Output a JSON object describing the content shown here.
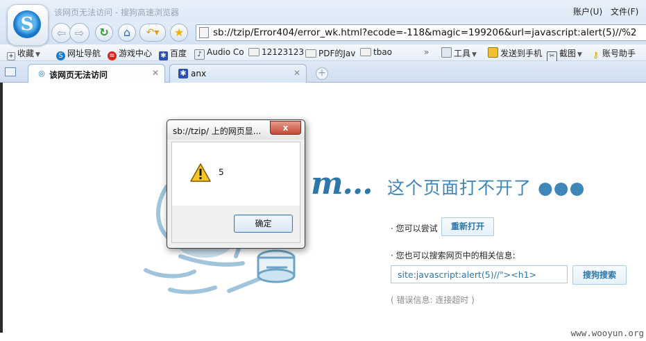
{
  "window": {
    "title": "该网页无法访问 - 搜狗高速浏览器",
    "menu": {
      "account": "账户(U)",
      "file": "文件(F)"
    }
  },
  "toolbar": {
    "address": "sb://tzip/Error404/error_wk.html?ecode=-118&magic=199206&url=javascript:alert(5)//%2"
  },
  "bookmarks": {
    "items": [
      "收藏",
      "网址导航",
      "游戏中心",
      "百度",
      "Audio Co",
      "12123123",
      "PDF的Jav",
      "tbao"
    ],
    "more": "»",
    "tools": [
      "工具",
      "发送到手机",
      "截图",
      "账号助手"
    ]
  },
  "tabs": [
    {
      "label": "该网页无法访问",
      "active": true
    },
    {
      "label": "anx",
      "active": false
    }
  ],
  "page": {
    "logo_text": "m...",
    "heading": "这个页面打不开了 ●●●",
    "try_label": "· 您可以尝试",
    "reopen_button": "重新打开",
    "search_label": "· 您也可以搜索网页中的相关信息:",
    "search_value": "site:javascript:alert(5)//\"><h1>",
    "search_button": "搜狗搜索",
    "error_info": "( 错误信息: 连接超时 )",
    "watermark": "www.wooyun.org"
  },
  "dialog": {
    "title": "sb://tzip/ 上的网页显...",
    "close_label": "x",
    "message": "5",
    "ok_label": "确定"
  },
  "colors": {
    "accent": "#3f87b8",
    "chrome": "#dde9f7",
    "close_button": "#c44a36"
  }
}
